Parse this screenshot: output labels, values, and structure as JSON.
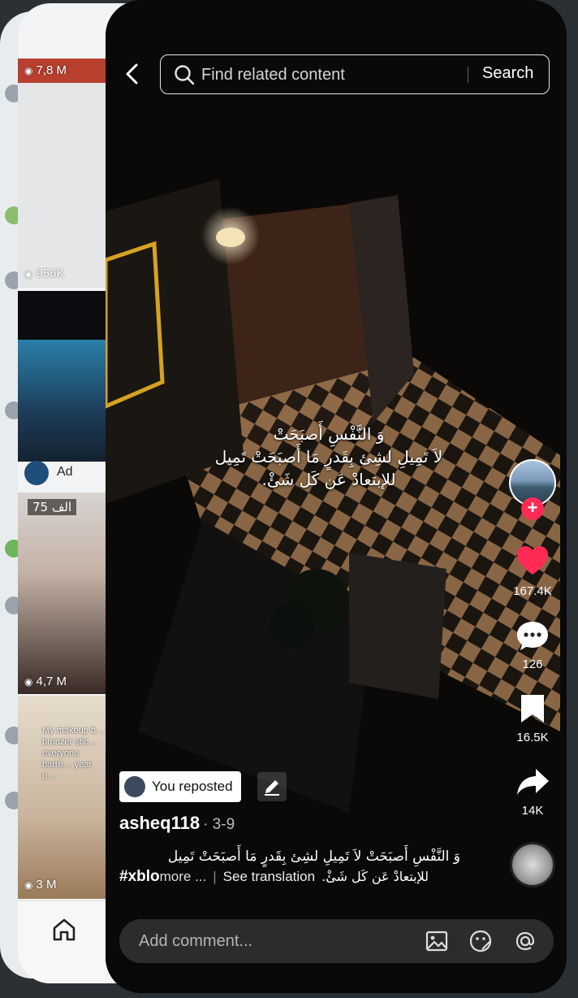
{
  "background_feed": {
    "tiles": [
      {
        "views": "7,8 M"
      },
      {
        "views": "956K"
      },
      {
        "ad_label": "Ad"
      },
      {
        "badge": "75 الف",
        "views": "4,7 M"
      },
      {
        "views": "3 M",
        "overlay_text": "My makeup b… bronzer stic… everyone barre… year u…"
      }
    ]
  },
  "search": {
    "placeholder": "Find related content",
    "button": "Search"
  },
  "video": {
    "caption_lines": [
      "وَ النَّفْسِ أَصبَحَتْ",
      "لاَ تَمِيلِ لشِئ بِقَدرٍ مَا أَصبَحَتْ تَمِيل",
      "للإبتعادْ عَن كَل شَئْ."
    ]
  },
  "rail": {
    "likes": "167.4K",
    "comments": "126",
    "saves": "16.5K",
    "shares": "14K"
  },
  "post": {
    "repost_label": "You reposted",
    "author": "asheq118",
    "date": "· 3-9",
    "description_line1": "وَ النَّفْسِ أَصبَحَتْ لاَ تَمِيلِ لشِئ بِقَدرٍ مَا أَصبَحَتْ تَمِيل",
    "hashtag": "#xblo",
    "more": "more ...",
    "pipe": "|",
    "see_translation": "See translation",
    "description_tail": "للإبتعادْ عَن كَل شَئْ."
  },
  "comment": {
    "placeholder": "Add comment..."
  },
  "colors": {
    "like": "#fe2c55",
    "follow": "#fe2c55"
  }
}
